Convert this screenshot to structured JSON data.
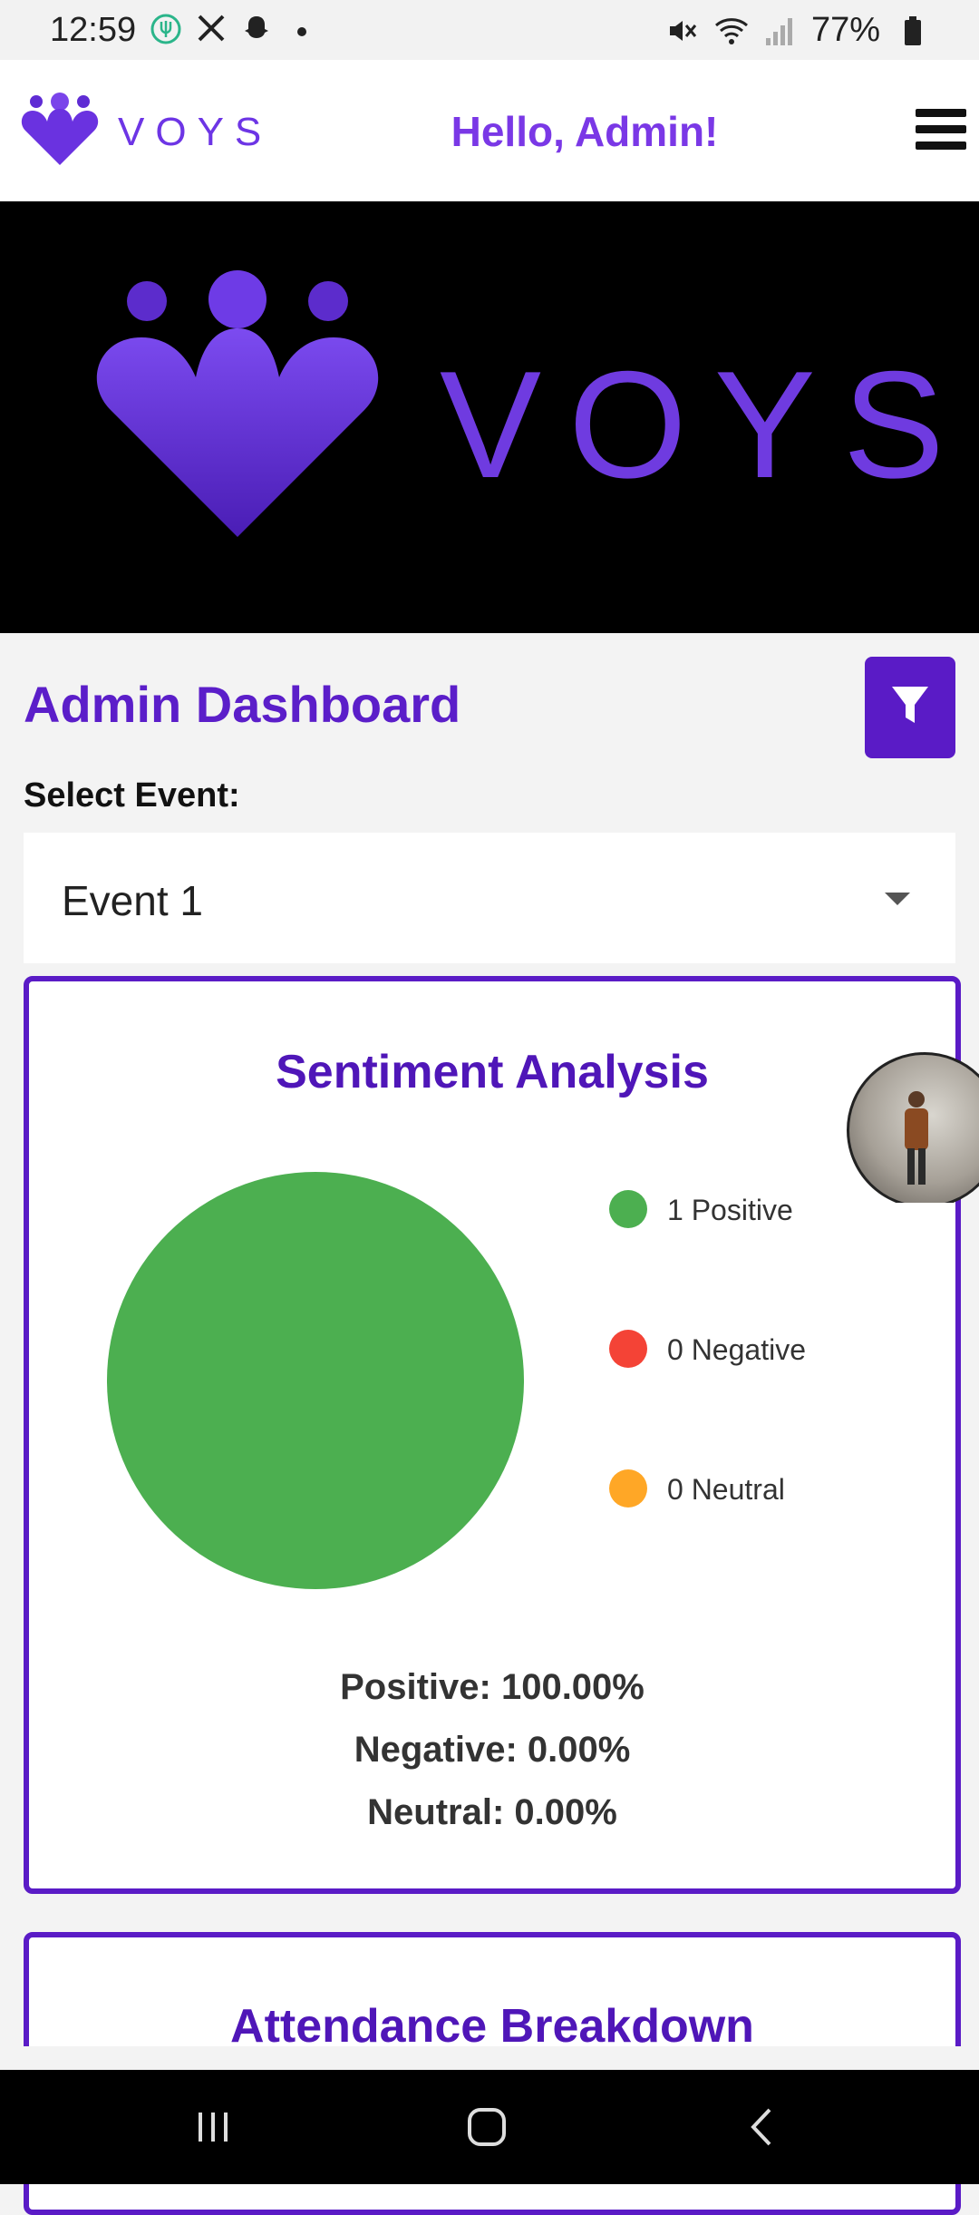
{
  "status_bar": {
    "time": "12:59",
    "battery": "77%",
    "left_icons": [
      "fork-icon",
      "x-icon",
      "snapchat-icon",
      "dot-icon"
    ],
    "right_icons": [
      "mute-icon",
      "wifi-icon",
      "signal-icon",
      "battery-icon"
    ]
  },
  "header": {
    "brand": "VOYS",
    "greeting": "Hello, Admin!",
    "menu_icon": "hamburger-icon"
  },
  "hero": {
    "brand": "VOYS"
  },
  "dashboard": {
    "title": "Admin Dashboard",
    "filter_icon": "filter-icon",
    "select_label": "Select Event:",
    "selected_event": "Event 1"
  },
  "sentiment": {
    "title": "Sentiment Analysis",
    "legend": [
      {
        "count": "1",
        "label": "Positive",
        "text": "1 Positive",
        "color": "#4caf50"
      },
      {
        "count": "0",
        "label": "Negative",
        "text": "0 Negative",
        "color": "#f44336"
      },
      {
        "count": "0",
        "label": "Neutral",
        "text": "0 Neutral",
        "color": "#ffa726"
      }
    ],
    "stats": {
      "positive": "Positive: 100.00%",
      "negative": "Negative: 0.00%",
      "neutral": "Neutral: 0.00%"
    }
  },
  "chart_data": {
    "type": "pie",
    "title": "Sentiment Analysis",
    "categories": [
      "Positive",
      "Negative",
      "Neutral"
    ],
    "values": [
      1,
      0,
      0
    ],
    "colors": [
      "#4caf50",
      "#f44336",
      "#ffa726"
    ],
    "legend_position": "right"
  },
  "attendance": {
    "title": "Attendance Breakdown"
  },
  "nav_bar": {
    "items": [
      "recents-icon",
      "home-icon",
      "back-icon"
    ]
  },
  "theme": {
    "accent": "#5a1bc6",
    "brand_purple": "#6d35e5"
  }
}
